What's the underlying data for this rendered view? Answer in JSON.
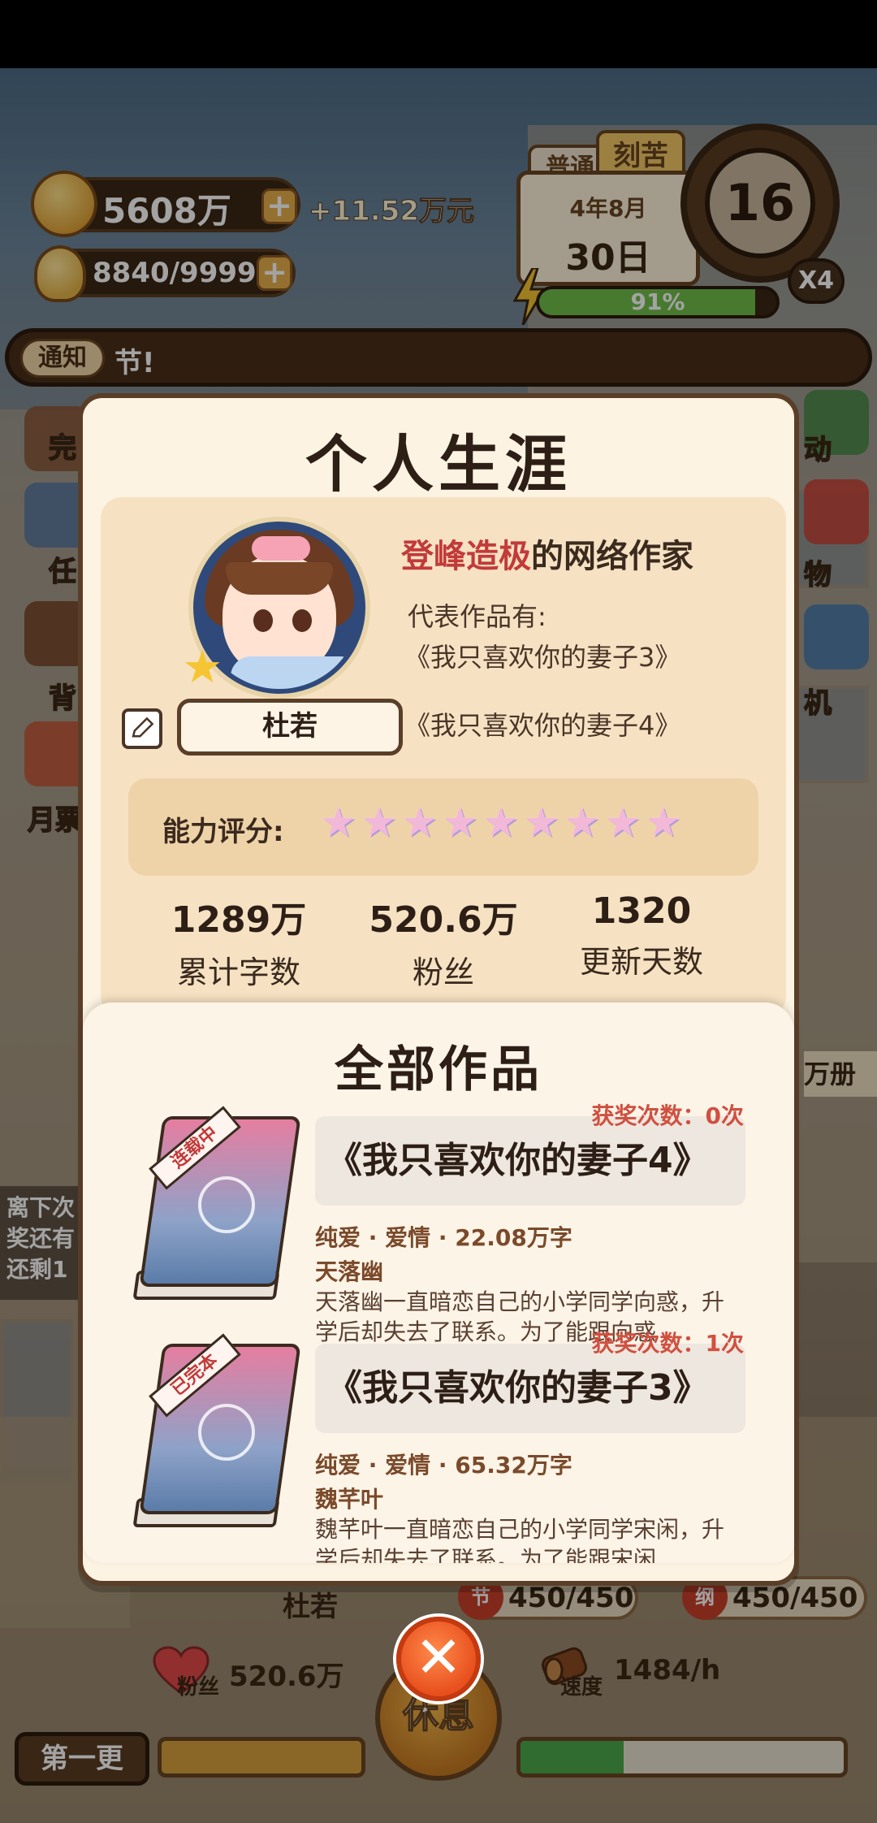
{
  "hud": {
    "money": "5608万",
    "money_delta": "+11.52万元",
    "energy": "8840/9999",
    "calendar_tab_normal": "普通",
    "calendar_tab_hard": "刻苦",
    "calendar_month": "4年8月",
    "calendar_day": "30日",
    "clock_hour": "16",
    "speed_multiplier": "X4",
    "stamina_percent": "91%",
    "stamina_level": 0.91
  },
  "notice": {
    "tag": "通知",
    "text": "节!"
  },
  "background": {
    "side_labels": [
      "完",
      "任",
      "背",
      "月票",
      "动",
      "物",
      "机"
    ],
    "float_msg": "离下次奖还有还剩1",
    "right_tip": "万册",
    "bottom_name": "杜若",
    "pill_a_badge": "节",
    "pill_a_value": "450/450",
    "pill_b_badge": "纲",
    "pill_b_value": "450/450",
    "fans_label": "粉丝",
    "fans_value": "520.6万",
    "speed_label": "速度",
    "speed_value": "1484/h",
    "first_update": "第一更",
    "rest_label": "休息",
    "writing_progress": 0.32
  },
  "career": {
    "title": "个人生涯",
    "rank_highlight": "登峰造极",
    "rank_suffix": "的网络作家",
    "rep_label": "代表作品有:",
    "rep_work_1": "《我只喜欢你的妻子3》",
    "rep_work_2": "《我只喜欢你的妻子4》",
    "author_name": "杜若",
    "ability_label": "能力评分:",
    "ability_stars": 9,
    "stats": [
      {
        "value": "1289万",
        "label": "累计字数"
      },
      {
        "value": "520.6万",
        "label": "粉丝"
      },
      {
        "value": "1320",
        "label": "更新天数"
      }
    ]
  },
  "works": {
    "title": "全部作品",
    "items": [
      {
        "status": "连载中",
        "title": "《我只喜欢你的妻子4》",
        "award": "获奖次数：0次",
        "meta": "纯爱 · 爱情 · 22.08万字",
        "lead": "天落幽",
        "desc": "天落幽一直暗恋自己的小学同学向惑，升学后却失去了联系。为了能跟向惑"
      },
      {
        "status": "已完本",
        "title": "《我只喜欢你的妻子3》",
        "award": "获奖次数：1次",
        "meta": "纯爱 · 爱情 · 65.32万字",
        "lead": "魏芊叶",
        "desc": "魏芊叶一直暗恋自己的小学同学宋闲，升学后却失去了联系。为了能跟宋闲"
      }
    ]
  },
  "close_icon": "close-icon",
  "colors": {
    "accent_red": "#c23a3a",
    "panel_bg": "#fdf3e2",
    "close_orange": "#e8501e"
  }
}
